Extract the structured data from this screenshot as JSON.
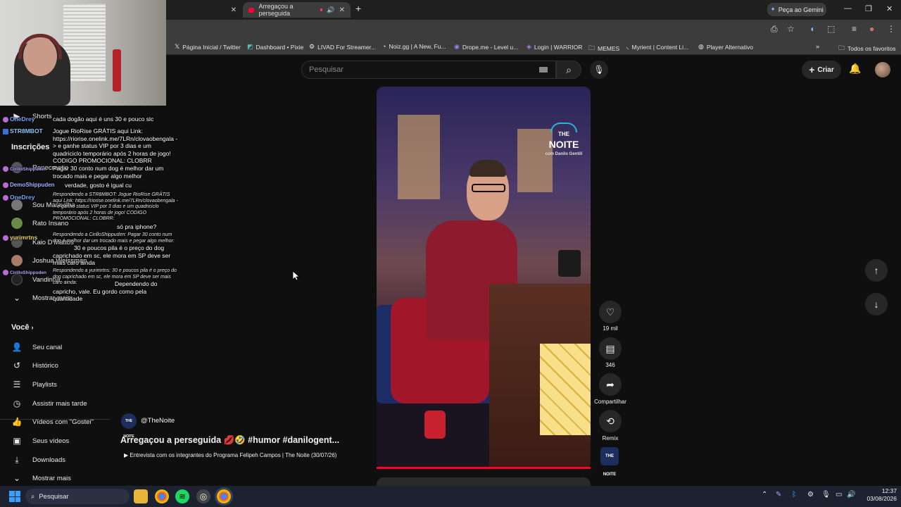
{
  "browser": {
    "tabs": [
      {
        "title": ""
      },
      {
        "title": "Arregaçou a perseguida"
      }
    ],
    "gemini_label": "Peça ao Gemini",
    "bookmarks": [
      {
        "label": "Página Inicial / Twitter",
        "icon": "x-icon"
      },
      {
        "label": "Dashboard • Pixie",
        "icon": "dashboard-icon"
      },
      {
        "label": "LIVAD For Streamer...",
        "icon": "livad-icon"
      },
      {
        "label": "Noiz.gg | A New, Fu...",
        "icon": "noiz-icon"
      },
      {
        "label": "Drope.me - Level u...",
        "icon": "drope-icon"
      },
      {
        "label": "Login | WARRIOR",
        "icon": "warrior-icon"
      },
      {
        "label": "MEMES",
        "icon": "folder-icon"
      },
      {
        "label": "Myrient | Content Li...",
        "icon": "myrient-icon"
      },
      {
        "label": "Player Alternativo",
        "icon": "globe-icon"
      }
    ],
    "all_favorites": "Todos os favoritos"
  },
  "youtube": {
    "search_placeholder": "Pesquisar",
    "create_label": "Criar"
  },
  "sidebar": {
    "shorts": "Shorts",
    "subscriptions_header": "Inscrições",
    "subscriptions": [
      {
        "name": "Renecreatio"
      },
      {
        "name": "Sou Maravilha"
      },
      {
        "name": "Rato Insano"
      },
      {
        "name": "Kaio D'Mattos"
      },
      {
        "name": "Joshua Weissman"
      },
      {
        "name": "Vandinha"
      },
      {
        "name": "Mostrar mais"
      }
    ],
    "you_header": "Você",
    "you_items": [
      {
        "label": "Seu canal",
        "icon": "user-icon"
      },
      {
        "label": "Histórico",
        "icon": "history-icon"
      },
      {
        "label": "Playlists",
        "icon": "playlist-icon"
      },
      {
        "label": "Assistir mais tarde",
        "icon": "clock-icon"
      },
      {
        "label": "Vídeos com \"Gostei\"",
        "icon": "thumbs-up-icon"
      },
      {
        "label": "Seus vídeos",
        "icon": "video-icon"
      },
      {
        "label": "Downloads",
        "icon": "download-icon"
      },
      {
        "label": "Mostrar mais",
        "icon": "chevron-down-icon"
      }
    ]
  },
  "chat": [
    {
      "user": "OneDrey",
      "text": "cada dogão aqui é uns 30 e pouco slc"
    },
    {
      "user": "STR8MBOT",
      "text": "Jogue RioRise GRÁTIS aqui Link: https://riorise.onelink.me/7LRn/clovaobengala -> e ganhe status VIP por 3 dias e um quadriciclo temporário após 2 horas de jogo! CODIGO PROMOCIONAL: CLOBRR"
    },
    {
      "user": "CirilloShippuden",
      "text": "Pagar 30 conto num dog é melhor dar um trocado mais e pegar algo melhor"
    },
    {
      "user": "DemoShippuden",
      "text": "verdade, gosto é igual cu"
    },
    {
      "user": "OneDrey",
      "reply": "Respondendo a STR8MBOT: Jogue RioRise GRÁTIS aqui Link: https://riorise.onelink.me/7LRn/clovaobengala -> e ganhe status VIP por 3 dias e um quadriciclo temporário após 2 horas de jogo! CODIGO PROMOCIONAL: CLOBRR:",
      "text": "só pra iphone?"
    },
    {
      "user": "yurimrtns",
      "reply": "Respondendo a CirilloShippuden: Pagar 30 conto num dog é melhor dar um trocado mais e pegar algo melhor:",
      "text": "30 e poucos pila é o preço do dog caprichado em sc, ele mora em SP deve ser mais caro ainda"
    },
    {
      "user": "CirilloShippuden",
      "reply": "Respondendo a yurimrtns: 30 e poucos pila é o preço do dog caprichado em sc, ele mora em SP deve ser mais caro ainda:",
      "text": "Dependendo do capricho, vale. Eu gordo como pela quantidade"
    }
  ],
  "short": {
    "channel_logo_text": "THE NOITE",
    "channel_logo_small": "com Danilo Gentili",
    "likes": "19 mil",
    "comments": "346",
    "share_label": "Compartilhar",
    "remix_label": "Remix",
    "channel": "@TheNoite",
    "title": "Arregaçou a perseguida 💋🤣 #humor #danilogent...",
    "subtitle": "▶ Entrevista com os integrantes do Programa Felipeh Campos | The Noite (30/07/26)"
  },
  "taskbar": {
    "search_label": "Pesquisar",
    "time": "12:37",
    "date": "03/08/2026"
  },
  "colors": {
    "accent_red": "#ff0033",
    "bg": "#0f0f0f"
  }
}
